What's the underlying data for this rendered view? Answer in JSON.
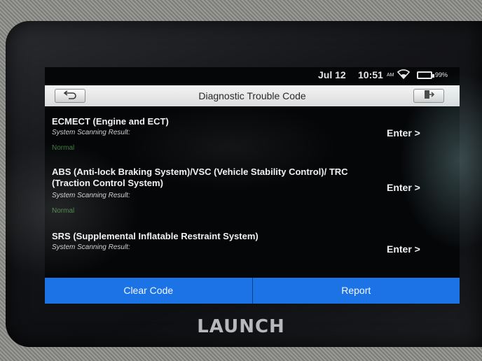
{
  "status": {
    "date": "Jul 12",
    "time": "10:51",
    "ampm": "AM",
    "battery": "99%"
  },
  "header": {
    "title": "Diagnostic Trouble Code"
  },
  "systems": [
    {
      "name": "ECMECT (Engine and ECT)",
      "scan_label": "System Scanning Result:",
      "scan_result": "Normal",
      "enter_label": "Enter >"
    },
    {
      "name": "ABS (Anti-lock Braking System)/VSC (Vehicle Stability Control)/ TRC (Traction Control System)",
      "scan_label": "System Scanning Result:",
      "scan_result": "Normal",
      "enter_label": "Enter >"
    },
    {
      "name": "SRS (Supplemental Inflatable Restraint System)",
      "scan_label": "System Scanning Result:",
      "enter_label": "Enter >"
    }
  ],
  "footer": {
    "clear_code": "Clear Code",
    "report": "Report"
  },
  "brand": "LAUNCH",
  "colors": {
    "accent": "#1c73e6",
    "result_ok": "#4fa34a"
  }
}
